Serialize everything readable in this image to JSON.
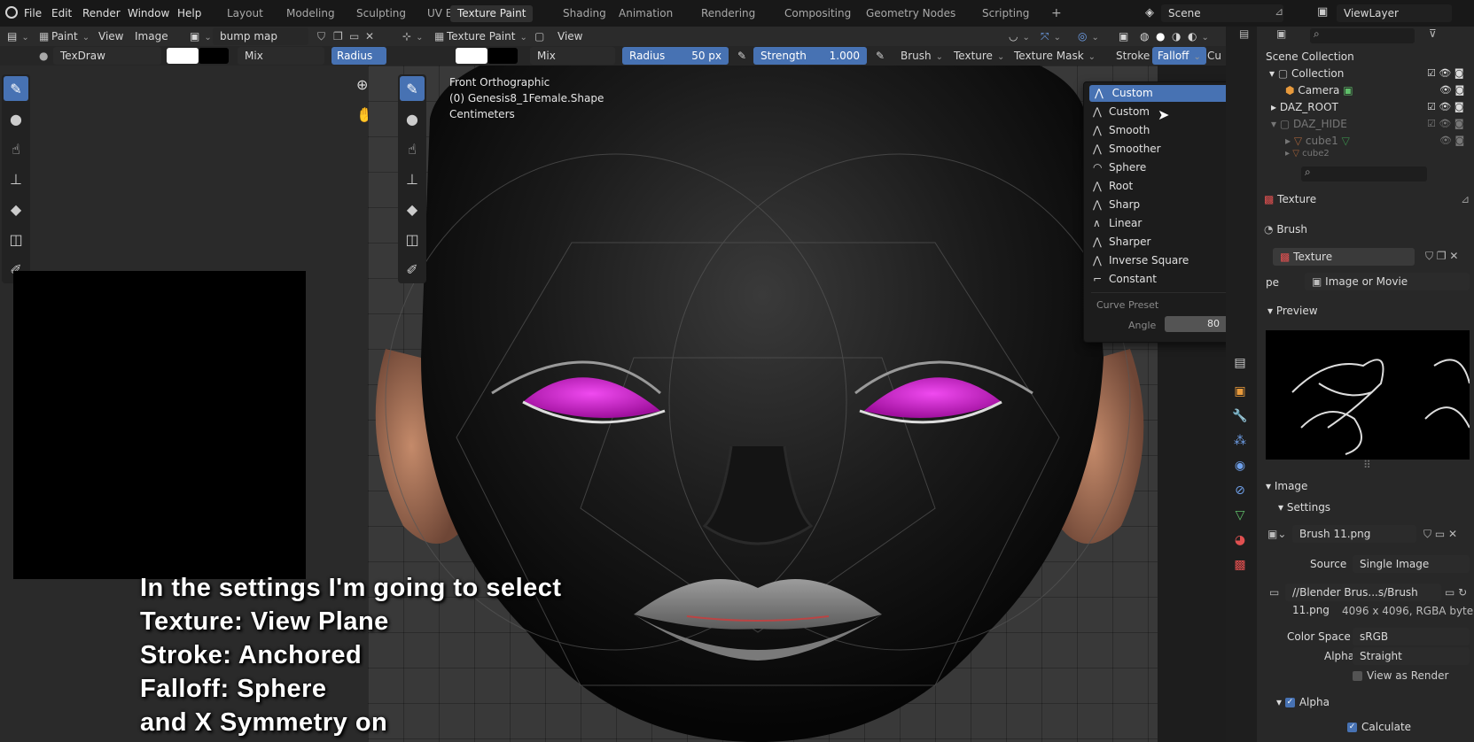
{
  "topbar": {
    "menus": [
      "File",
      "Edit",
      "Render",
      "Window",
      "Help"
    ],
    "workspaces": [
      "Layout",
      "Modeling",
      "Sculpting",
      "UV Editing",
      "Texture Paint",
      "Shading",
      "Animation",
      "Rendering",
      "Compositing",
      "Geometry Nodes",
      "Scripting"
    ],
    "active_workspace": "Texture Paint",
    "add_tab": "+",
    "scene": "Scene",
    "view_layer": "ViewLayer"
  },
  "image_editor": {
    "mode": "Paint",
    "view": "View",
    "image": "Image",
    "image_name": "bump map",
    "brush": "TexDraw",
    "blend": "Mix",
    "radius_label": "Radius"
  },
  "viewport": {
    "mode": "Texture Paint",
    "view": "View",
    "blend": "Mix",
    "radius_label": "Radius",
    "radius_value": "50 px",
    "strength_label": "Strength",
    "strength_value": "1.000",
    "menus": [
      "Brush",
      "Texture",
      "Texture Mask",
      "Stroke",
      "Falloff",
      "Cu"
    ],
    "info": [
      "Front Orthographic",
      "(0) Genesis8_1Female.Shape",
      "Centimeters"
    ]
  },
  "falloff_menu": {
    "selected": "Custom",
    "items": [
      "Custom",
      "Smooth",
      "Smoother",
      "Sphere",
      "Root",
      "Sharp",
      "Linear",
      "Sharper",
      "Inverse Square",
      "Constant"
    ],
    "curve_preset": "Curve Preset",
    "angle_label": "Angle",
    "angle_value": "80"
  },
  "caption": [
    "In the settings I'm going to select",
    "Texture: View Plane",
    "Stroke: Anchored",
    "Falloff: Sphere",
    "and X Symmetry on"
  ],
  "outliner": {
    "title": "Scene Collection",
    "items": [
      "Collection",
      "Camera",
      "DAZ_ROOT",
      "DAZ_HIDE",
      "cube1",
      "cube2"
    ]
  },
  "properties": {
    "texture_header": "Texture",
    "brush": "Brush",
    "texture_name": "Texture",
    "type_label": "pe",
    "type_value": "Image or Movie",
    "preview": "Preview",
    "image_panel": "Image",
    "settings": "Settings",
    "image_file": "Brush 11.png",
    "source_label": "Source",
    "source_value": "Single Image",
    "filepath": "//Blender Brus...s/Brush 11.png",
    "resolution": "4096 x 4096,  RGBA byte",
    "color_space_label": "Color Space",
    "color_space_value": "sRGB",
    "alpha_label": "Alpha",
    "alpha_value": "Straight",
    "view_as_render": "View as Render",
    "alpha_section": "Alpha",
    "calculate": "Calculate"
  },
  "colors": {
    "accent": "#4772b3",
    "eye": "#d41bd4"
  }
}
